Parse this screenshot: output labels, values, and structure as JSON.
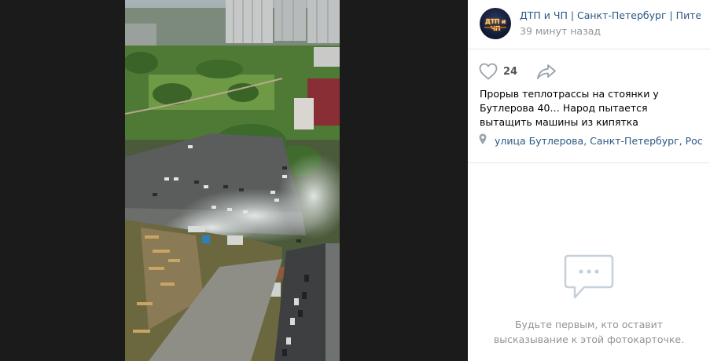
{
  "post": {
    "author": "ДТП и ЧП | Санкт-Петербург | Пите…",
    "avatar_text": "ДТП и ЧП",
    "time": "39 минут назад",
    "likes": "24",
    "caption": "Прорыв теплотрассы на стоянки у Бутлерова 40… Народ пытается вытащить машины из кипятка",
    "location": "улица Бутлерова, Санкт-Петербург, Рос…"
  },
  "comments": {
    "empty_text": "Будьте первым, кто оставит высказывание к этой фотокарточке."
  },
  "icons": {
    "like": "heart-icon",
    "share": "share-arrow-icon",
    "location": "map-pin-icon",
    "empty": "chat-bubble-icon"
  },
  "colors": {
    "link": "#2a5885",
    "muted": "#939393",
    "icon": "#99a2ad",
    "viewer_bg": "#1b1b1b"
  }
}
